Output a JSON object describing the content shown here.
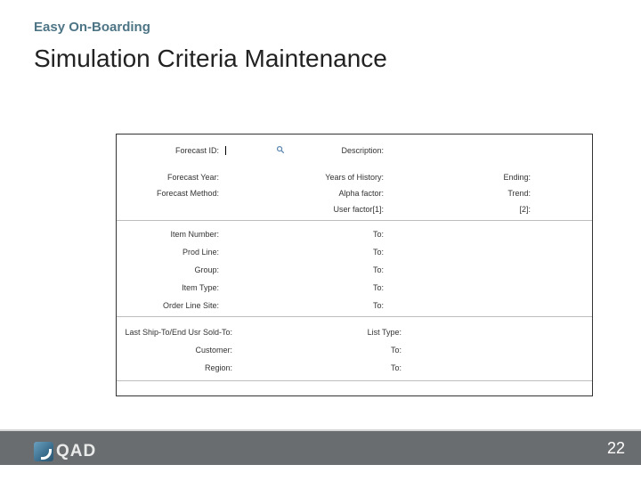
{
  "eyebrow": "Easy On-Boarding",
  "title": "Simulation Criteria Maintenance",
  "form": {
    "forecast_id": "Forecast ID:",
    "description": "Description:",
    "forecast_year": "Forecast Year:",
    "years_of_history": "Years of History:",
    "ending": "Ending:",
    "forecast_method": "Forecast Method:",
    "alpha_factor": "Alpha factor:",
    "trend": "Trend:",
    "user_factor1": "User factor[1]:",
    "user_factor2": "[2]:",
    "item_number": "Item Number:",
    "to1": "To:",
    "prod_line": "Prod Line:",
    "to2": "To:",
    "group": "Group:",
    "to3": "To:",
    "item_type": "Item Type:",
    "to4": "To:",
    "order_line_site": "Order Line Site:",
    "to5": "To:",
    "last_ship_to": "Last Ship-To/End Usr Sold-To:",
    "list_type": "List Type:",
    "customer": "Customer:",
    "to6": "To:",
    "region": "Region:",
    "to7": "To:"
  },
  "logo_text": "QAD",
  "page_number": "22"
}
